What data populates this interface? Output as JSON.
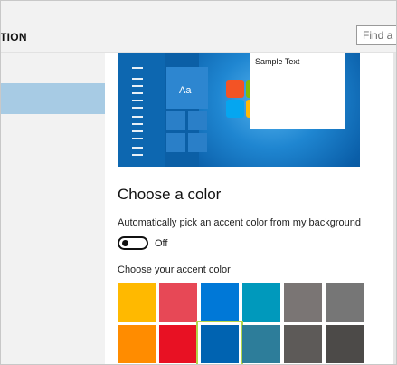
{
  "header": {
    "title": "TION",
    "search_placeholder": "Find a s"
  },
  "preview": {
    "sample_text": "Sample Text",
    "tile_text": "Aa"
  },
  "colors": {
    "header_bg": "#f2f2f2",
    "sidebar_selected": "#a7cbe4",
    "selection_outline": "#b3d64a"
  },
  "main": {
    "title": "Choose a color",
    "auto_pick_label": "Automatically pick an accent color from my background",
    "toggle_state": "Off",
    "toggle_on": false,
    "accent_label": "Choose your accent color",
    "swatches": [
      {
        "color": "#ffb900",
        "selected": false
      },
      {
        "color": "#e74856",
        "selected": false
      },
      {
        "color": "#0078d7",
        "selected": false
      },
      {
        "color": "#0099bc",
        "selected": false
      },
      {
        "color": "#7a7574",
        "selected": false
      },
      {
        "color": "#767676",
        "selected": false
      },
      {
        "color": "#ff8c00",
        "selected": false
      },
      {
        "color": "#e81123",
        "selected": false
      },
      {
        "color": "#0063b1",
        "selected": true
      },
      {
        "color": "#2d7d9a",
        "selected": false
      },
      {
        "color": "#5d5a58",
        "selected": false
      },
      {
        "color": "#4c4a48",
        "selected": false
      }
    ]
  }
}
